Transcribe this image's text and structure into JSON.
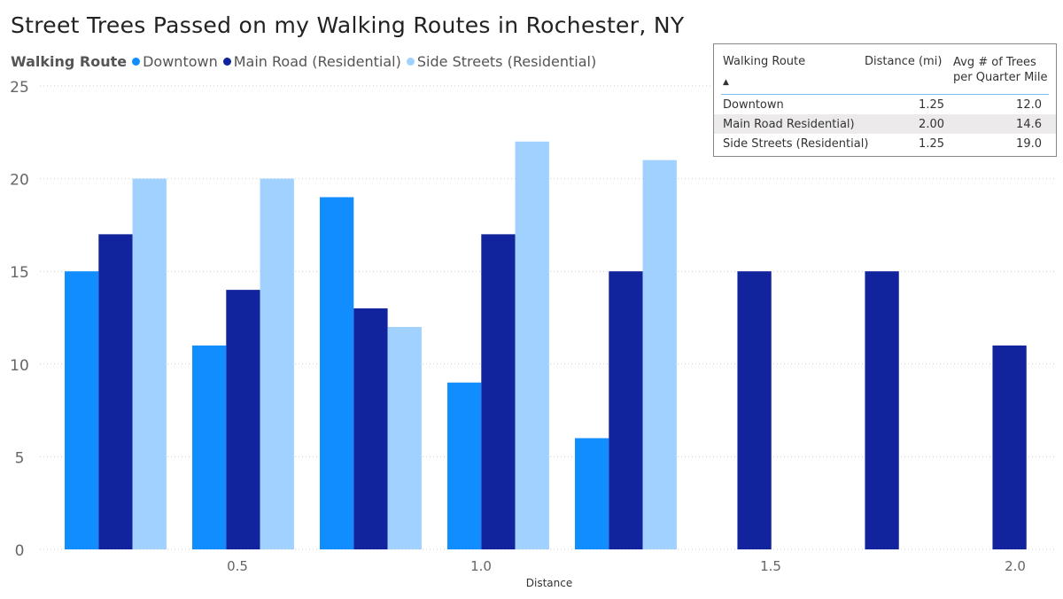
{
  "title": "Street Trees Passed on my Walking Routes in Rochester, NY",
  "legend": {
    "title": "Walking Route"
  },
  "table": {
    "headers": [
      "Walking Route",
      "Distance (mi)",
      "Avg # of Trees per Quarter Mile"
    ],
    "sort_icon": "sort-ascending-icon",
    "rows": [
      [
        "Downtown",
        "1.25",
        "12.0"
      ],
      [
        "Main Road Residential)",
        "2.00",
        "14.6"
      ],
      [
        "Side Streets (Residential)",
        "1.25",
        "19.0"
      ]
    ]
  },
  "chart_data": {
    "type": "bar",
    "title": "Street Trees Passed on my Walking Routes in Rochester, NY",
    "xlabel": "Distance",
    "ylabel": "",
    "categories": [
      0.25,
      0.5,
      0.75,
      1.0,
      1.25,
      1.5,
      1.75,
      2.0
    ],
    "x_tick_labels": [
      "0.5",
      "1.0",
      "1.5",
      "2.0"
    ],
    "y_ticks": [
      0,
      5,
      10,
      15,
      20,
      25
    ],
    "ylim": [
      0,
      25
    ],
    "grid": true,
    "legend_placement": "top-left",
    "series": [
      {
        "name": "Downtown",
        "color": "#118dff",
        "values": [
          15,
          11,
          19,
          9,
          6,
          null,
          null,
          null
        ]
      },
      {
        "name": "Main Road (Residential)",
        "color": "#12239e",
        "values": [
          17,
          14,
          13,
          17,
          15,
          15,
          15,
          11
        ]
      },
      {
        "name": "Side Streets (Residential)",
        "color": "#a0d1ff",
        "values": [
          20,
          20,
          12,
          22,
          21,
          null,
          null,
          null
        ]
      }
    ]
  }
}
